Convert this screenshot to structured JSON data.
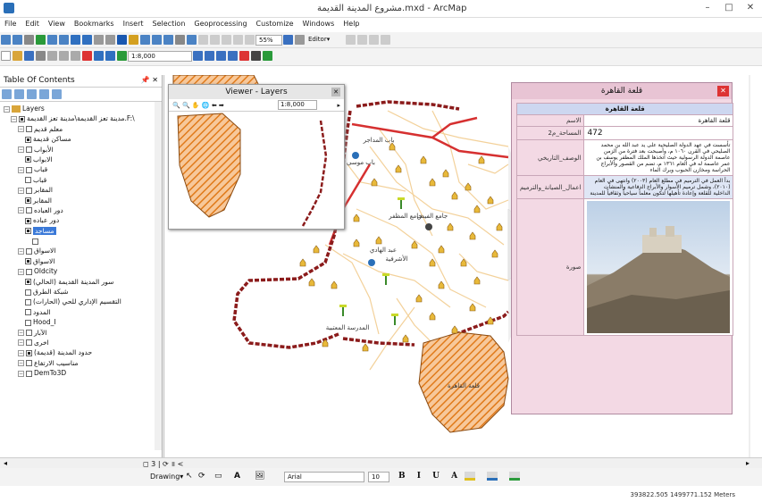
{
  "window": {
    "title": "مشروع المدينة القديمة.mxd - ArcMap",
    "min": "–",
    "max": "□",
    "close": "✕"
  },
  "menu": [
    "File",
    "Edit",
    "View",
    "Bookmarks",
    "Insert",
    "Selection",
    "Geoprocessing",
    "Customize",
    "Windows",
    "Help"
  ],
  "toolbar": {
    "scale": "1:8,000",
    "percent": "55%",
    "editor": "Editor▾"
  },
  "toc": {
    "title": "Table Of Contents",
    "pin": "📌 ✕",
    "root": "Layers",
    "items": [
      {
        "label": "مدينة تعز القديمة\\مدينة تعز القديمة.F:\\",
        "level": 1,
        "checked": true
      },
      {
        "label": "معلم قديم",
        "level": 2,
        "checked": false
      },
      {
        "label": "مساكن قديمة",
        "level": 3,
        "checked": true
      },
      {
        "label": "الأبواب",
        "level": 2,
        "checked": false
      },
      {
        "label": "الابواب",
        "level": 3,
        "checked": true
      },
      {
        "label": "قباب",
        "level": 2,
        "checked": false
      },
      {
        "label": "قباب",
        "level": 3,
        "checked": false
      },
      {
        "label": "المقابر",
        "level": 2,
        "checked": false
      },
      {
        "label": "المقابر",
        "level": 3,
        "checked": true
      },
      {
        "label": "دور العباده",
        "level": 2,
        "checked": false
      },
      {
        "label": "دور عباده",
        "level": 3,
        "checked": true
      },
      {
        "label": "مساجد",
        "level": 3,
        "checked": true,
        "selected": true
      },
      {
        "label": "",
        "level": 4,
        "checked": false
      },
      {
        "label": "الاسواق",
        "level": 2,
        "checked": false
      },
      {
        "label": "الاسواق",
        "level": 3,
        "checked": true
      },
      {
        "label": "Oldcity",
        "level": 2,
        "checked": false
      },
      {
        "label": "سور المدينة القديمة (الحالي)",
        "level": 3,
        "checked": true
      },
      {
        "label": "شبكة الطرق",
        "level": 3,
        "checked": false
      },
      {
        "label": "التقسيم الإداري للحي (الحارات)",
        "level": 3,
        "checked": false
      },
      {
        "label": "المدود",
        "level": 3,
        "checked": false
      },
      {
        "label": "Hood_I",
        "level": 3,
        "checked": false
      },
      {
        "label": "الآبار",
        "level": 2,
        "checked": false
      },
      {
        "label": "اخرى",
        "level": 2,
        "checked": false
      },
      {
        "label": "حدود المدينة (قديمة)",
        "level": 2,
        "checked": true
      },
      {
        "label": "مناسيب الارتفاع",
        "level": 2,
        "checked": false
      },
      {
        "label": "DemTo3D",
        "level": 2,
        "checked": false
      }
    ]
  },
  "viewer": {
    "title": "Viewer - Layers",
    "scale": "1:8,000",
    "close": "✕"
  },
  "popup": {
    "title": "قلعة القاهرة",
    "close": "✕",
    "caption": "قلعة القاهرة",
    "rows": [
      {
        "key": "الاسم",
        "value": "قلعة القاهرة"
      },
      {
        "key": "المساحة_م2",
        "value": "472"
      },
      {
        "key": "الوصف_التاريخي",
        "value": "تأسست في عهد الدولة الصليحية على يد عبد الله بن محمد الصليحي في القرن ١٠٦٠ م، وأصبحت بعد فترة من الزمن عاصمة الدولة الرسولية حيث اتخذها الملك المظفر يوسف بن عمر عاصمة له في العام ١٣٦١ م، تضم من القصور والأبراج الحراسة ومخازن الحبوب وبرك الماء"
      },
      {
        "key": "اعمال_الصيانة_والترميم",
        "value": "بدأ العمل في الترميم في مطلع العام (٢٠٠٣) وانتهى في العام (٢٠١٠)، وشمل ترميم الأسوار والأبراج الدفاعية والمنشآت الداخلية للقلعة وإعادة تأهيلها لتكون معلماً سياحياً وثقافياً للمدينة"
      },
      {
        "key": "صورة",
        "value": ""
      }
    ]
  },
  "map_labels": [
    "قلعة القاهرة",
    "جامع المظفر",
    "الأشرفية",
    "المدرسة المعتبية",
    "عبد الهادي",
    "باب موسى",
    "جامع الفيض",
    "باب المداجر"
  ],
  "statusbar": {
    "coords": "393822.505 1499771.152 Meters"
  },
  "hscroll": {
    "tabs": "◻ 3 | ⟳ ॥ <"
  },
  "drawbar": {
    "drawing": "Drawing▾",
    "font": "Arial",
    "size": "10",
    "format": "B I U A"
  },
  "colors": {
    "wall": "#8b1b1b",
    "roads_main": "#d63030",
    "roads_minor": "#f3d19a",
    "hatched_area": "#e07a1a",
    "popup_bg": "#f3d9e4",
    "selection": "#3a79d8"
  }
}
